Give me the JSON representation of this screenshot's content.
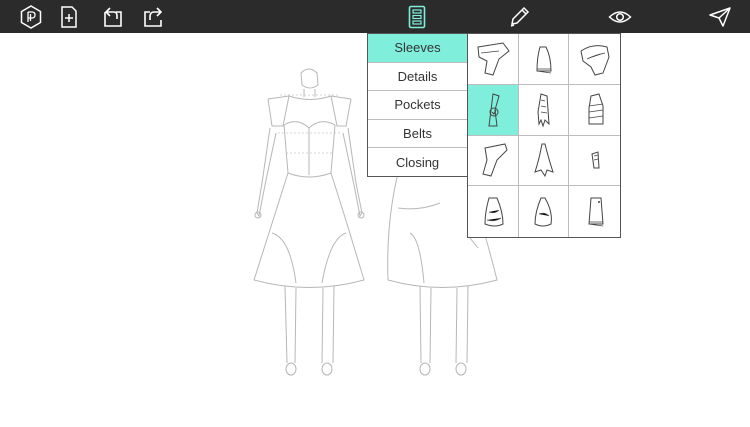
{
  "toolbar": {
    "left_icons": [
      "logo-icon",
      "new-file-icon",
      "undo-icon",
      "share-icon"
    ],
    "center_icon": "catalog-icon",
    "right_icons": [
      "pencil-icon",
      "eye-icon",
      "send-icon"
    ],
    "accent_color": "#7fefdc"
  },
  "category_menu": {
    "items": [
      "Sleeves",
      "Details",
      "Pockets",
      "Belts",
      "Closing"
    ],
    "selected": "Sleeves"
  },
  "sleeve_grid": {
    "rows": 4,
    "columns": 3,
    "selected_index": 3
  }
}
